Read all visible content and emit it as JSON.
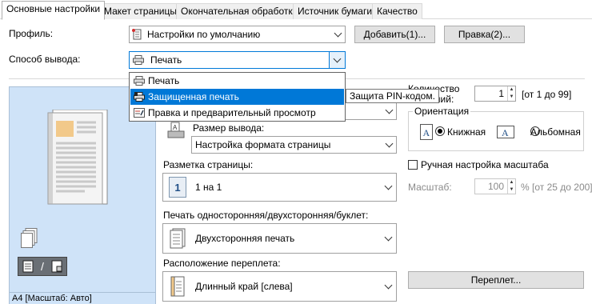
{
  "tabs": [
    {
      "label": "Основные настройки",
      "active": true
    },
    {
      "label": "Макет страницы",
      "active": false
    },
    {
      "label": "Окончательная обработка",
      "active": false
    },
    {
      "label": "Источник бумаги",
      "active": false
    },
    {
      "label": "Качество",
      "active": false
    }
  ],
  "profile": {
    "label": "Профиль:",
    "value": "Настройки по умолчанию",
    "add_button": "Добавить(1)...",
    "edit_button": "Правка(2)..."
  },
  "output_method": {
    "label": "Способ вывода:",
    "value": "Печать",
    "options": [
      {
        "label": "Печать",
        "icon": "printer-icon"
      },
      {
        "label": "Защищенная печать",
        "icon": "secure-print-icon",
        "selected": true
      },
      {
        "label": "Правка и предварительный просмотр",
        "icon": "edit-preview-icon"
      }
    ],
    "tooltip": "Защита PIN-кодом."
  },
  "preview": {
    "caption": "A4 [Масштаб: Авто]"
  },
  "output_size": {
    "label": "Размер вывода:",
    "value": "Настройка формата страницы"
  },
  "page_layout": {
    "label": "Разметка страницы:",
    "value": "1 на 1",
    "icon_text": "1"
  },
  "duplex": {
    "label": "Печать односторонняя/двухсторонняя/буклет:",
    "value": "Двухсторонняя печать"
  },
  "binding": {
    "label": "Расположение переплета:",
    "value": "Длинный край [слева]",
    "button": "Переплет..."
  },
  "copies": {
    "label_line1": "Количество",
    "label_line2": "копий:",
    "value": "1",
    "range": "[от 1 до 99]"
  },
  "orientation": {
    "title": "Ориентация",
    "portrait": "Книжная",
    "landscape": "Альбомная",
    "selected": "portrait"
  },
  "manual_scaling": {
    "label": "Ручная настройка масштаба",
    "checked": false,
    "scale_label": "Масштаб:",
    "scale_value": "100",
    "scale_range": "% [от 25 до 200]"
  },
  "colors": {
    "accent": "#0078d7",
    "preview_bg": "#cfe3f8"
  }
}
